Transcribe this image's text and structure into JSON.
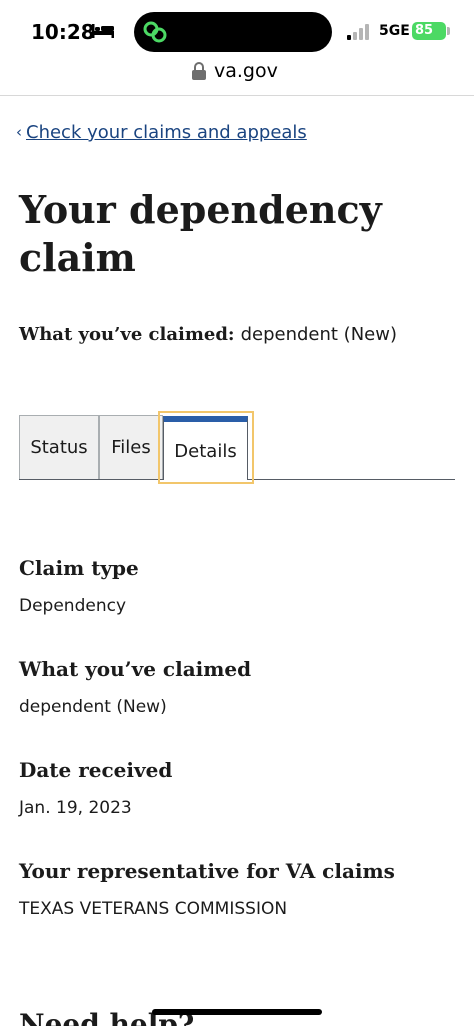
{
  "status_bar": {
    "time": "10:28",
    "network": "5GE",
    "battery": "85"
  },
  "url_bar": {
    "domain": "va.gov"
  },
  "breadcrumb": {
    "label": "Check your claims and appeals"
  },
  "title": "Your dependency claim",
  "summary": {
    "label": "What you’ve claimed:",
    "value": "dependent (New)"
  },
  "tabs": [
    {
      "label": "Status",
      "selected": false
    },
    {
      "label": "Files",
      "selected": false
    },
    {
      "label": "Details",
      "selected": true
    }
  ],
  "details": {
    "claim_type": {
      "label": "Claim type",
      "value": "Dependency"
    },
    "claimed": {
      "label": "What you’ve claimed",
      "value": "dependent (New)"
    },
    "date_received": {
      "label": "Date received",
      "value": "Jan. 19, 2023"
    },
    "representative": {
      "label": "Your representative for VA claims",
      "value": "TEXAS VETERANS COMMISSION"
    }
  },
  "next_heading": "Need help?",
  "icons": [
    "bed-icon",
    "link-icon",
    "signal-icon",
    "battery-icon",
    "lock-icon",
    "chevron-left-icon"
  ],
  "colors": {
    "link": "#1a4480",
    "tab_accent": "#2a5ea8",
    "focus": "#f2c66b",
    "battery": "#4cd964"
  }
}
